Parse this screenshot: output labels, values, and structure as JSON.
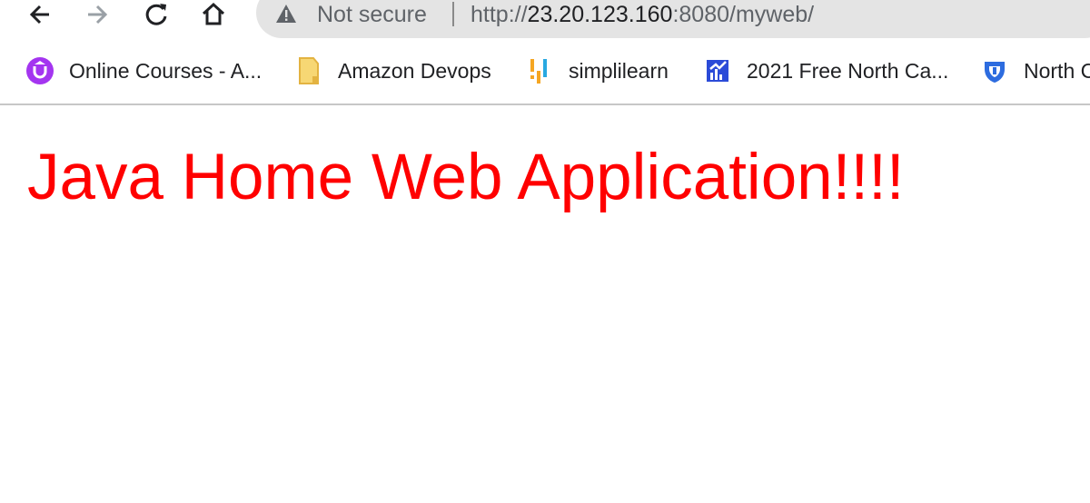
{
  "browser": {
    "address_bar": {
      "security_status": "Not secure",
      "url_scheme": "http://",
      "url_host": "23.20.123.160",
      "url_path": ":8080/myweb/"
    },
    "icons": {
      "back": "arrow-left-icon",
      "forward": "arrow-right-icon",
      "reload": "reload-icon",
      "home": "home-icon",
      "warning": "warning-triangle-icon"
    }
  },
  "bookmarks": [
    {
      "label": "Online Courses - A...",
      "icon": "udemy-icon",
      "color": "#a435f0"
    },
    {
      "label": "Amazon Devops",
      "icon": "folder-icon",
      "color": "#f7d774"
    },
    {
      "label": "simplilearn",
      "icon": "simplilearn-icon",
      "color": "#f5a623"
    },
    {
      "label": "2021 Free North Ca...",
      "icon": "chart-icon",
      "color": "#2b4bd8"
    },
    {
      "label": "North C",
      "icon": "north-icon",
      "color": "#2d6cdf"
    }
  ],
  "page": {
    "heading": "Java Home Web Application!!!!",
    "heading_color": "#ff0000"
  }
}
